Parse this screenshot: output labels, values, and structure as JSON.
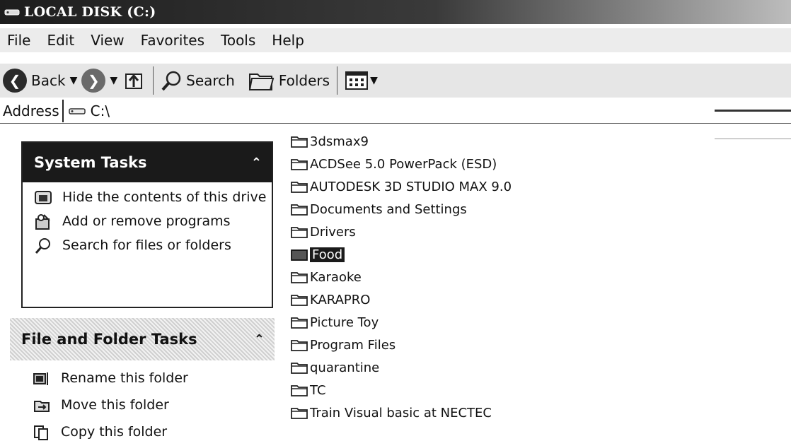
{
  "window": {
    "title": "LOCAL DISK (C:)"
  },
  "menu": [
    "File",
    "Edit",
    "View",
    "Favorites",
    "Tools",
    "Help"
  ],
  "toolbar": {
    "back_label": "Back",
    "search_label": "Search",
    "folders_label": "Folders"
  },
  "address": {
    "label": "Address",
    "value": "C:\\"
  },
  "system_tasks": {
    "title": "System Tasks",
    "items": [
      {
        "label": "Hide the contents of this drive",
        "icon": "hide-contents-icon"
      },
      {
        "label": "Add or remove programs",
        "icon": "add-remove-programs-icon"
      },
      {
        "label": "Search for files or folders",
        "icon": "search-icon"
      }
    ]
  },
  "file_folder_tasks": {
    "title": "File and Folder Tasks",
    "items": [
      {
        "label": "Rename this folder",
        "icon": "rename-icon"
      },
      {
        "label": "Move this folder",
        "icon": "move-icon"
      },
      {
        "label": "Copy this folder",
        "icon": "copy-icon"
      }
    ]
  },
  "files": [
    {
      "name": "3dsmax9"
    },
    {
      "name": "ACDSee 5.0 PowerPack (ESD)"
    },
    {
      "name": "AUTODESK 3D STUDIO MAX 9.0"
    },
    {
      "name": "Documents and Settings"
    },
    {
      "name": "Drivers"
    },
    {
      "name": "Food",
      "selected": true
    },
    {
      "name": "Karaoke"
    },
    {
      "name": "KARAPRO"
    },
    {
      "name": "Picture Toy"
    },
    {
      "name": "Program Files"
    },
    {
      "name": "quarantine"
    },
    {
      "name": "TC"
    },
    {
      "name": "Train Visual basic at NECTEC"
    }
  ]
}
